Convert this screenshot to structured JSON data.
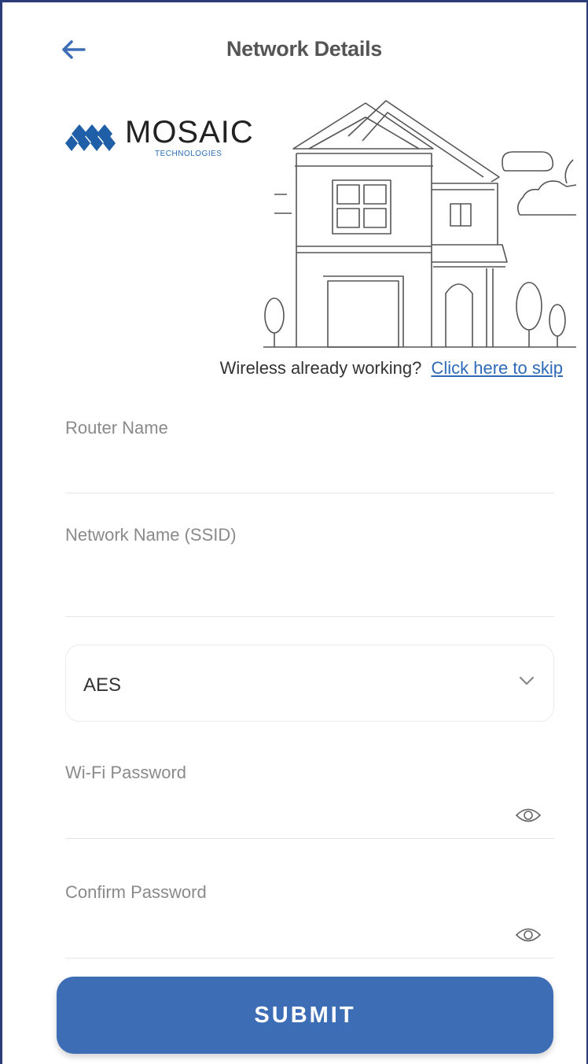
{
  "header": {
    "back_icon": "arrow-left-icon",
    "title": "Network Details"
  },
  "logo": {
    "name": "MOSAIC",
    "tagline": "TECHNOLOGIES",
    "brand_color": "#1f5fa8"
  },
  "skip": {
    "prompt": "Wireless already working?",
    "link": "Click here to skip"
  },
  "form": {
    "router_name": {
      "label": "Router Name",
      "value": ""
    },
    "network_name": {
      "label": "Network Name (SSID)",
      "value": ""
    },
    "encryption": {
      "selected": "AES",
      "icon": "chevron-down-icon"
    },
    "wifi_password": {
      "label": "Wi-Fi Password",
      "value": "",
      "icon": "eye-icon"
    },
    "confirm_password": {
      "label": "Confirm Password",
      "value": "",
      "icon": "eye-icon"
    }
  },
  "submit_label": "SUBMIT",
  "colors": {
    "accent": "#3d6db5",
    "link": "#2e6ab8",
    "frame": "#2b3b78",
    "label": "#8a8a8a"
  }
}
